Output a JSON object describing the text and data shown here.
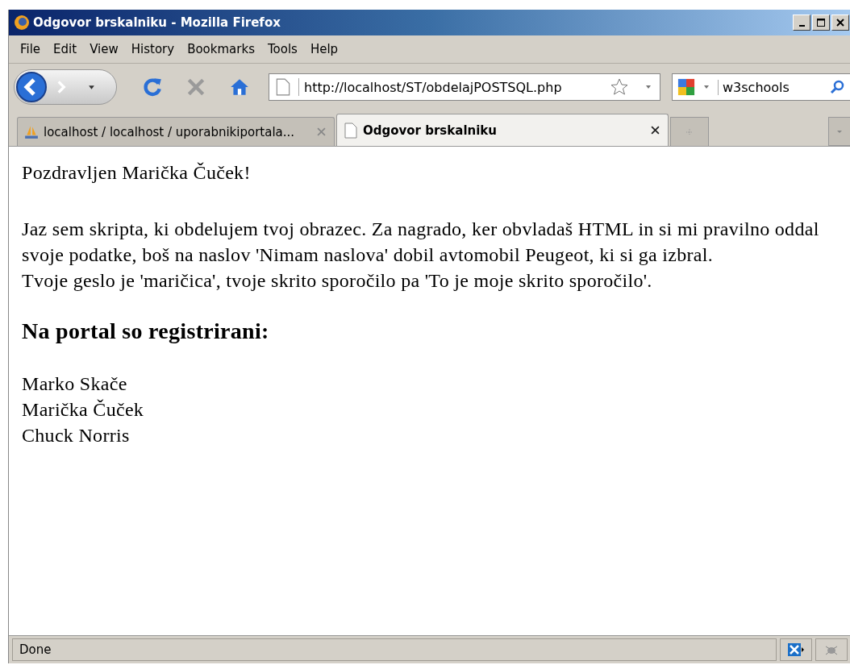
{
  "window": {
    "title": "Odgovor brskalniku - Mozilla Firefox"
  },
  "menu": [
    "File",
    "Edit",
    "View",
    "History",
    "Bookmarks",
    "Tools",
    "Help"
  ],
  "address": {
    "value": "http://localhost/ST/obdelajPOSTSQL.php"
  },
  "search": {
    "value": "w3schools"
  },
  "tabs": [
    {
      "label": "localhost / localhost / uporabnikiportala...",
      "selected": false
    },
    {
      "label": "Odgovor brskalniku",
      "selected": true
    }
  ],
  "page": {
    "greeting": "Pozdravljen Marička Čuček!",
    "lines": [
      "Jaz sem skripta, ki obdelujem tvoj obrazec. Za nagrado, ker obvladaš HTML in si mi pravilno oddal svoje podatke, boš na naslov 'Nimam naslova' dobil avtomobil Peugeot, ki si ga izbral.",
      "Tvoje geslo je 'maričica', tvoje skrito sporočilo pa 'To je moje skrito sporočilo'."
    ],
    "heading": "Na portal so registrirani:",
    "users": [
      "Marko Skače",
      "Marička Čuček",
      "Chuck Norris"
    ]
  },
  "status_bar": {
    "text": "Done"
  }
}
